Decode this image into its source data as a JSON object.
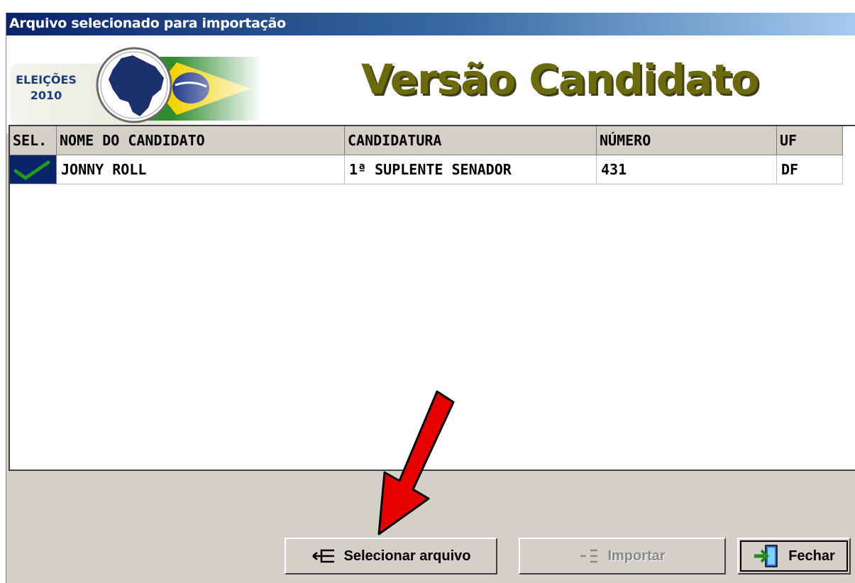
{
  "window": {
    "title": "Arquivo selecionado para importação"
  },
  "banner": {
    "logo_line1": "ELEIÇÕES",
    "logo_line2": "2010",
    "heading": "Versão Candidato"
  },
  "grid": {
    "columns": [
      "SEL.",
      "NOME DO CANDIDATO",
      "CANDIDATURA",
      "NÚMERO",
      "UF"
    ],
    "rows": [
      {
        "selected": true,
        "nome": "JONNY ROLL",
        "candidatura": "1ª SUPLENTE SENADOR",
        "numero": "431",
        "uf": "DF"
      }
    ]
  },
  "buttons": {
    "select_label": "Selecionar arquivo",
    "import_label": "Importar",
    "close_label": "Fechar"
  },
  "icons": {
    "select": "tree-select-icon",
    "import": "tree-import-icon",
    "close": "exit-door-icon",
    "check": "check-icon"
  },
  "colors": {
    "title_start": "#0a246a",
    "heading": "#6b6b0e",
    "check": "#1f9a1f",
    "arrow": "#e60000"
  }
}
